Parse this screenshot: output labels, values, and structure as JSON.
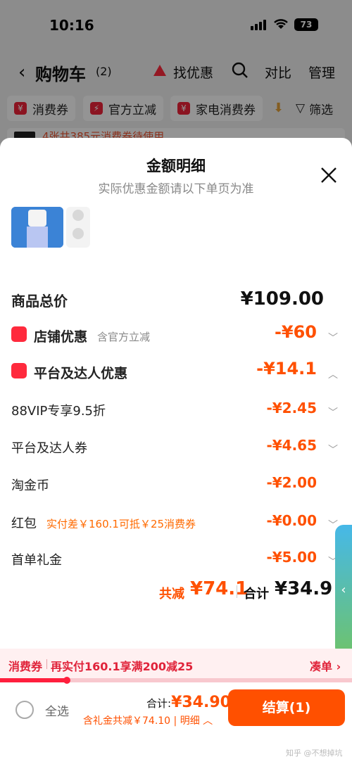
{
  "status": {
    "time": "10:16",
    "battery": "73"
  },
  "nav": {
    "title": "购物车",
    "count": "(2)",
    "deal": "找优惠",
    "compare": "对比",
    "manage": "管理"
  },
  "filters": {
    "chips": [
      "消费券",
      "官方立减",
      "家电消费券"
    ],
    "filter": "筛选"
  },
  "strip": {
    "text": "4张共385元消费券待使用"
  },
  "sheet": {
    "title": "金额明细",
    "subtitle": "实际优惠金额请以下单页为准",
    "total_label": "商品总价",
    "total_amount": "¥109.00",
    "shop": {
      "label": "店铺优惠",
      "note": "含官方立减",
      "amount": "-¥60"
    },
    "platform": {
      "label": "平台及达人优惠",
      "amount": "-¥14.1"
    },
    "items": [
      {
        "label": "88VIP专享9.5折",
        "amount": "-¥2.45",
        "note": ""
      },
      {
        "label": "平台及达人券",
        "amount": "-¥4.65",
        "note": ""
      },
      {
        "label": "淘金币",
        "amount": "-¥2.00",
        "note": ""
      },
      {
        "label": "红包",
        "amount": "-¥0.00",
        "note": "实付差￥160.1可抵￥25消费券"
      },
      {
        "label": "首单礼金",
        "amount": "-¥5.00",
        "note": ""
      }
    ],
    "save_label": "共减",
    "save_amount": "¥74.1",
    "sum_label": "合计",
    "sum_amount": "¥34.9"
  },
  "coupon_bar": {
    "tag": "消费券",
    "text": "再实付160.1享满200减25",
    "action": "凑单 ›",
    "progress": 0.19
  },
  "bottom": {
    "select_all": "全选",
    "total_prefix": "合计:",
    "total": "¥34.90",
    "gift_note": "含礼金共减￥74.10 | 明细",
    "checkout": "结算(1)"
  },
  "watermark": "知乎 @不想掉坑"
}
